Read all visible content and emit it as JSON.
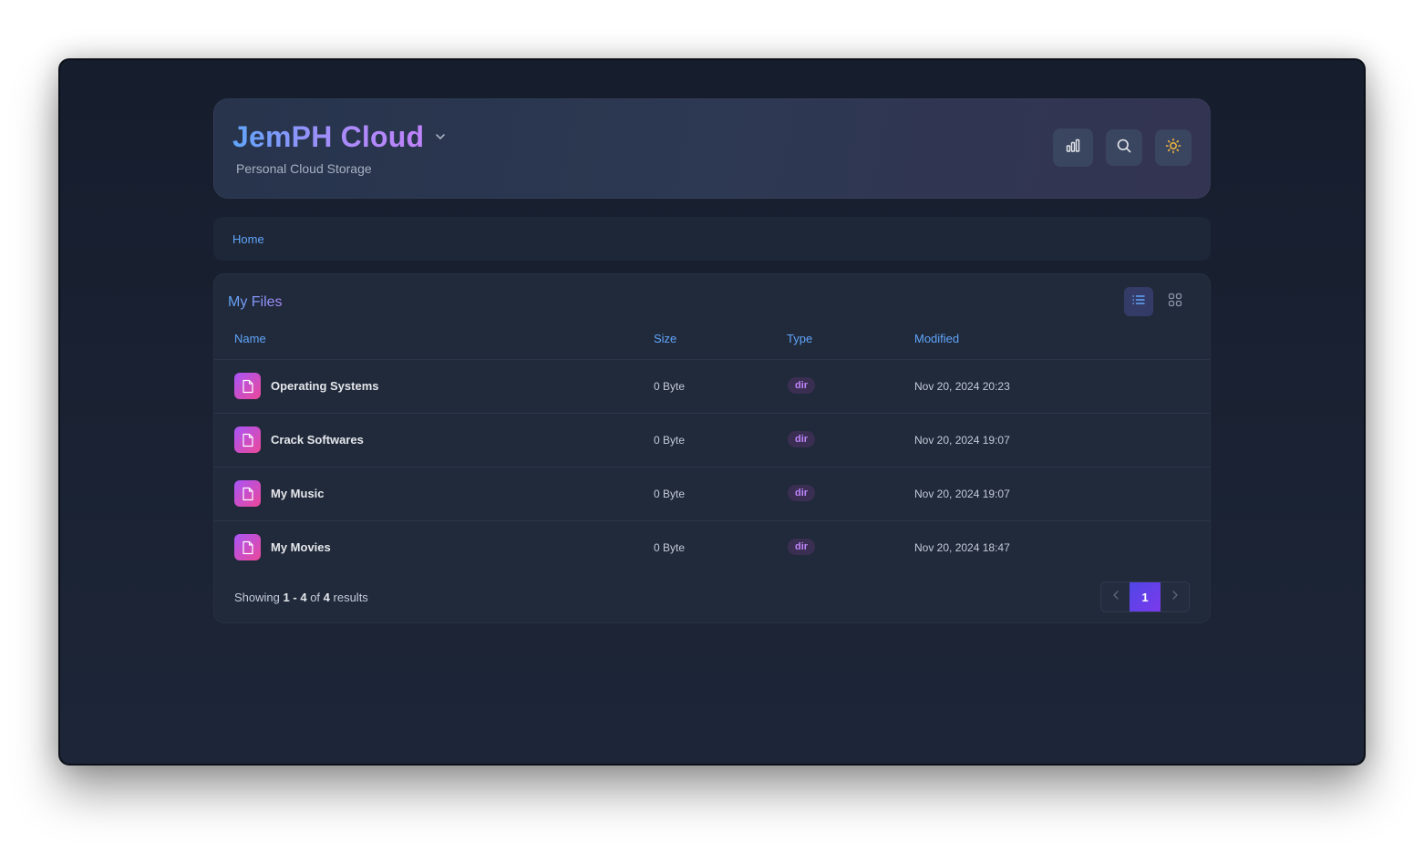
{
  "app": {
    "title": "JemPH Cloud",
    "subtitle": "Personal Cloud Storage"
  },
  "header_actions": [
    {
      "icon": "bar-chart-icon"
    },
    {
      "icon": "search-icon"
    },
    {
      "icon": "sun-icon"
    }
  ],
  "breadcrumb": {
    "home_label": "Home"
  },
  "files": {
    "title": "My Files",
    "columns": {
      "name": "Name",
      "size": "Size",
      "type": "Type",
      "modified": "Modified"
    },
    "rows": [
      {
        "name": "Operating Systems",
        "size": "0 Byte",
        "type": "dir",
        "modified": "Nov 20, 2024 20:23"
      },
      {
        "name": "Crack Softwares",
        "size": "0 Byte",
        "type": "dir",
        "modified": "Nov 20, 2024 19:07"
      },
      {
        "name": "My Music",
        "size": "0 Byte",
        "type": "dir",
        "modified": "Nov 20, 2024 19:07"
      },
      {
        "name": "My Movies",
        "size": "0 Byte",
        "type": "dir",
        "modified": "Nov 20, 2024 18:47"
      }
    ],
    "view_mode": "list"
  },
  "pagination": {
    "prefix": "Showing",
    "from": "1",
    "dash": "-",
    "to": "4",
    "of": "of",
    "total": "4",
    "suffix": "results",
    "current_page": "1"
  },
  "colors": {
    "accent_blue": "#60a5fa",
    "accent_purple": "#a78bfa",
    "badge_text": "#c084fc",
    "sun": "#f5b93a"
  }
}
